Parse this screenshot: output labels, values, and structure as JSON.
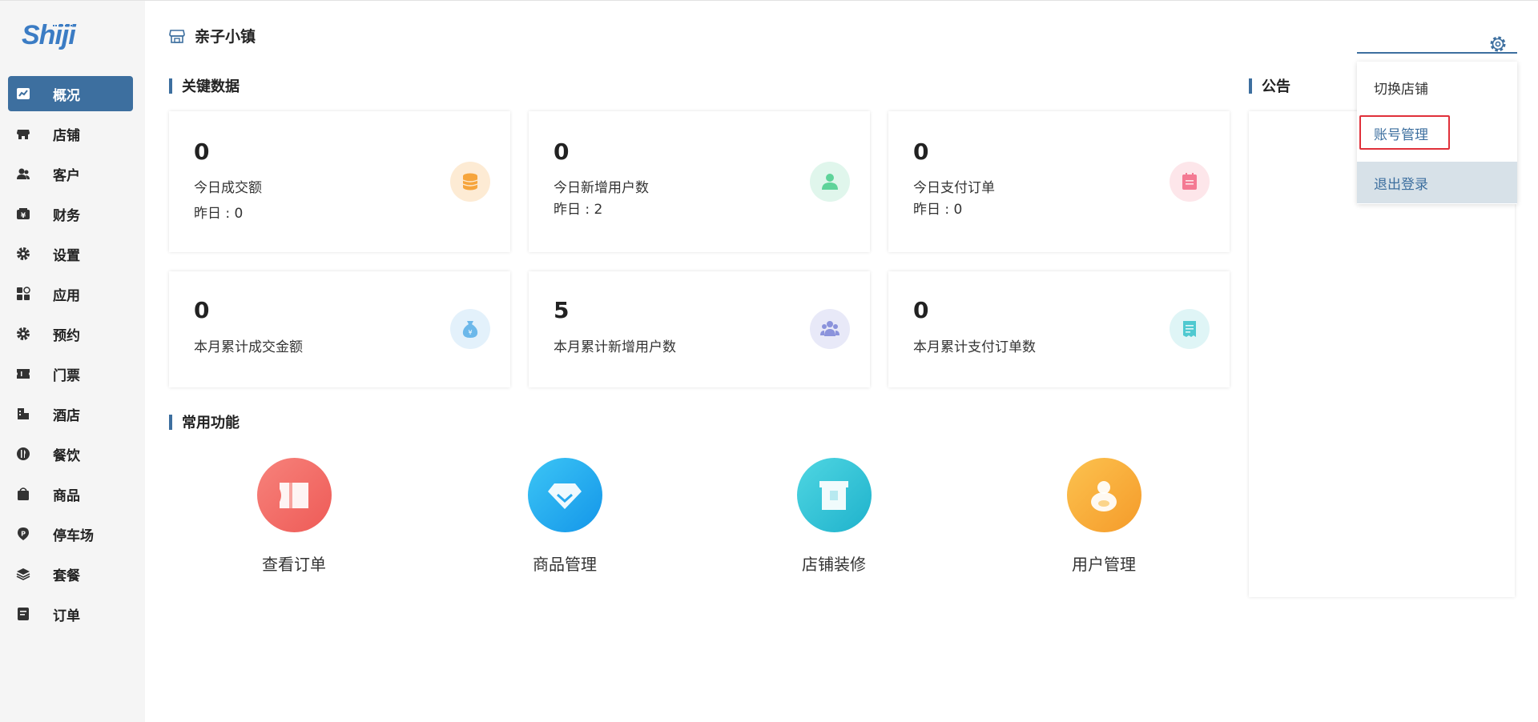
{
  "logo": {
    "text": "Shiji"
  },
  "colors": {
    "accent": "#3d6f9f",
    "sidebar_bg": "#f5f5f5",
    "highlight_box": "#e0303a"
  },
  "sidebar": {
    "items": [
      {
        "label": "概况",
        "icon": "chart-icon",
        "active": true
      },
      {
        "label": "店铺",
        "icon": "store-icon"
      },
      {
        "label": "客户",
        "icon": "users-icon"
      },
      {
        "label": "财务",
        "icon": "wallet-icon"
      },
      {
        "label": "设置",
        "icon": "gear-icon"
      },
      {
        "label": "应用",
        "icon": "apps-icon"
      },
      {
        "label": "预约",
        "icon": "gear-icon"
      },
      {
        "label": "门票",
        "icon": "ticket-icon"
      },
      {
        "label": "酒店",
        "icon": "hotel-icon"
      },
      {
        "label": "餐饮",
        "icon": "dining-icon"
      },
      {
        "label": "商品",
        "icon": "bag-icon"
      },
      {
        "label": "停车场",
        "icon": "parking-icon"
      },
      {
        "label": "套餐",
        "icon": "layers-icon"
      },
      {
        "label": "订单",
        "icon": "order-icon"
      }
    ]
  },
  "header": {
    "title": "亲子小镇"
  },
  "key_data": {
    "title": "关键数据",
    "cards": [
      {
        "value": "0",
        "label": "今日成交额",
        "sub": "昨日 : 0",
        "icon": "coins-icon"
      },
      {
        "value": "0",
        "label": "今日新增用户数",
        "sub": "昨日 : 2",
        "icon": "user-icon"
      },
      {
        "value": "0",
        "label": "今日支付订单",
        "sub": "昨日 : 0",
        "icon": "clipboard-icon"
      },
      {
        "value": "0",
        "label": "本月累计成交金额",
        "icon": "money-bag-icon"
      },
      {
        "value": "5",
        "label": "本月累计新增用户数",
        "icon": "group-icon"
      },
      {
        "value": "0",
        "label": "本月累计支付订单数",
        "icon": "receipt-icon"
      }
    ]
  },
  "functions": {
    "title": "常用功能",
    "items": [
      {
        "label": "查看订单",
        "icon": "ticket-icon"
      },
      {
        "label": "商品管理",
        "icon": "diamond-icon"
      },
      {
        "label": "店铺装修",
        "icon": "box-icon"
      },
      {
        "label": "用户管理",
        "icon": "person-icon"
      }
    ]
  },
  "notice": {
    "title": "公告"
  },
  "dropdown": {
    "items": [
      {
        "label": "切换店铺"
      },
      {
        "label": "账号管理"
      },
      {
        "label": "退出登录"
      }
    ]
  }
}
